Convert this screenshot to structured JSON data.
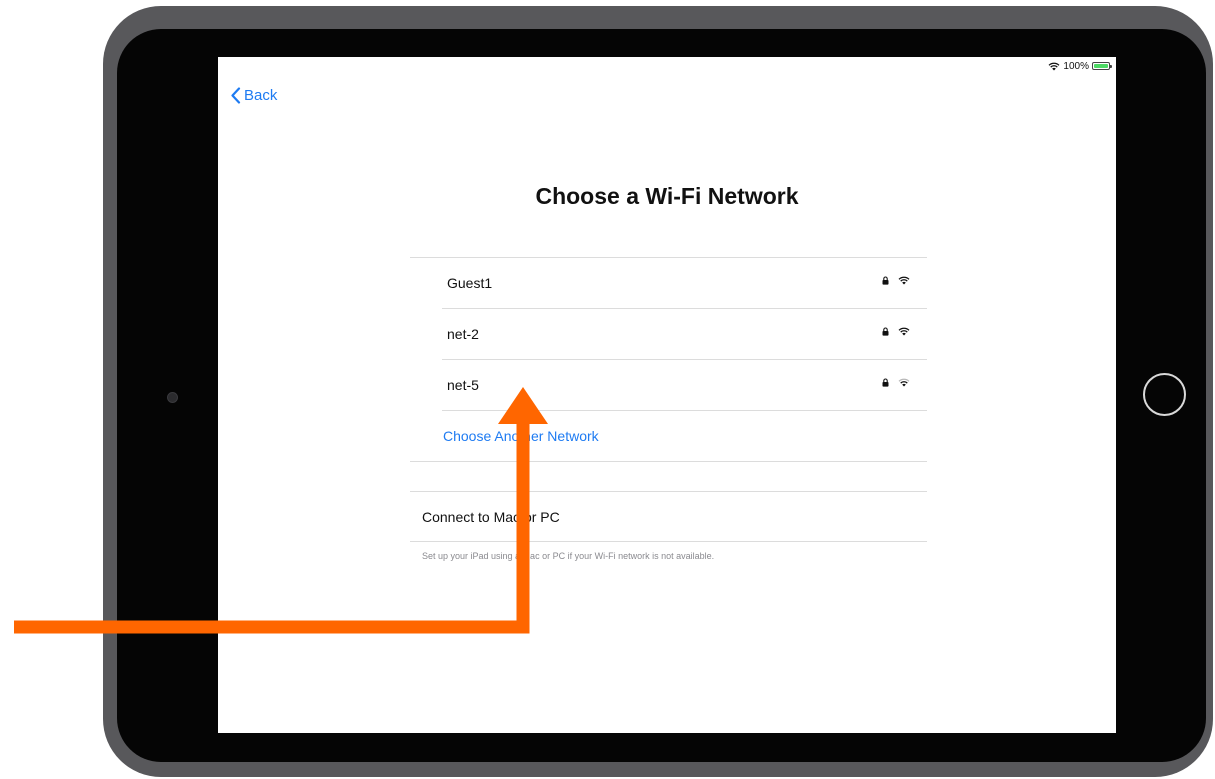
{
  "status_bar": {
    "battery_percent": "100%"
  },
  "nav": {
    "back_label": "Back"
  },
  "page": {
    "title": "Choose a Wi-Fi Network"
  },
  "networks": [
    {
      "name": "Guest1",
      "secured": true,
      "signal": "full"
    },
    {
      "name": "net-2",
      "secured": true,
      "signal": "full"
    },
    {
      "name": "net-5",
      "secured": true,
      "signal": "medium"
    }
  ],
  "other_network_label": "Choose Another Network",
  "connect": {
    "label": "Connect to Mac or PC",
    "footnote": "Set up your iPad using a Mac or PC if your Wi-Fi network is not available."
  },
  "colors": {
    "accent": "#1e7bf2",
    "annotation_arrow": "#ff6600",
    "bezel": "#58585b"
  }
}
